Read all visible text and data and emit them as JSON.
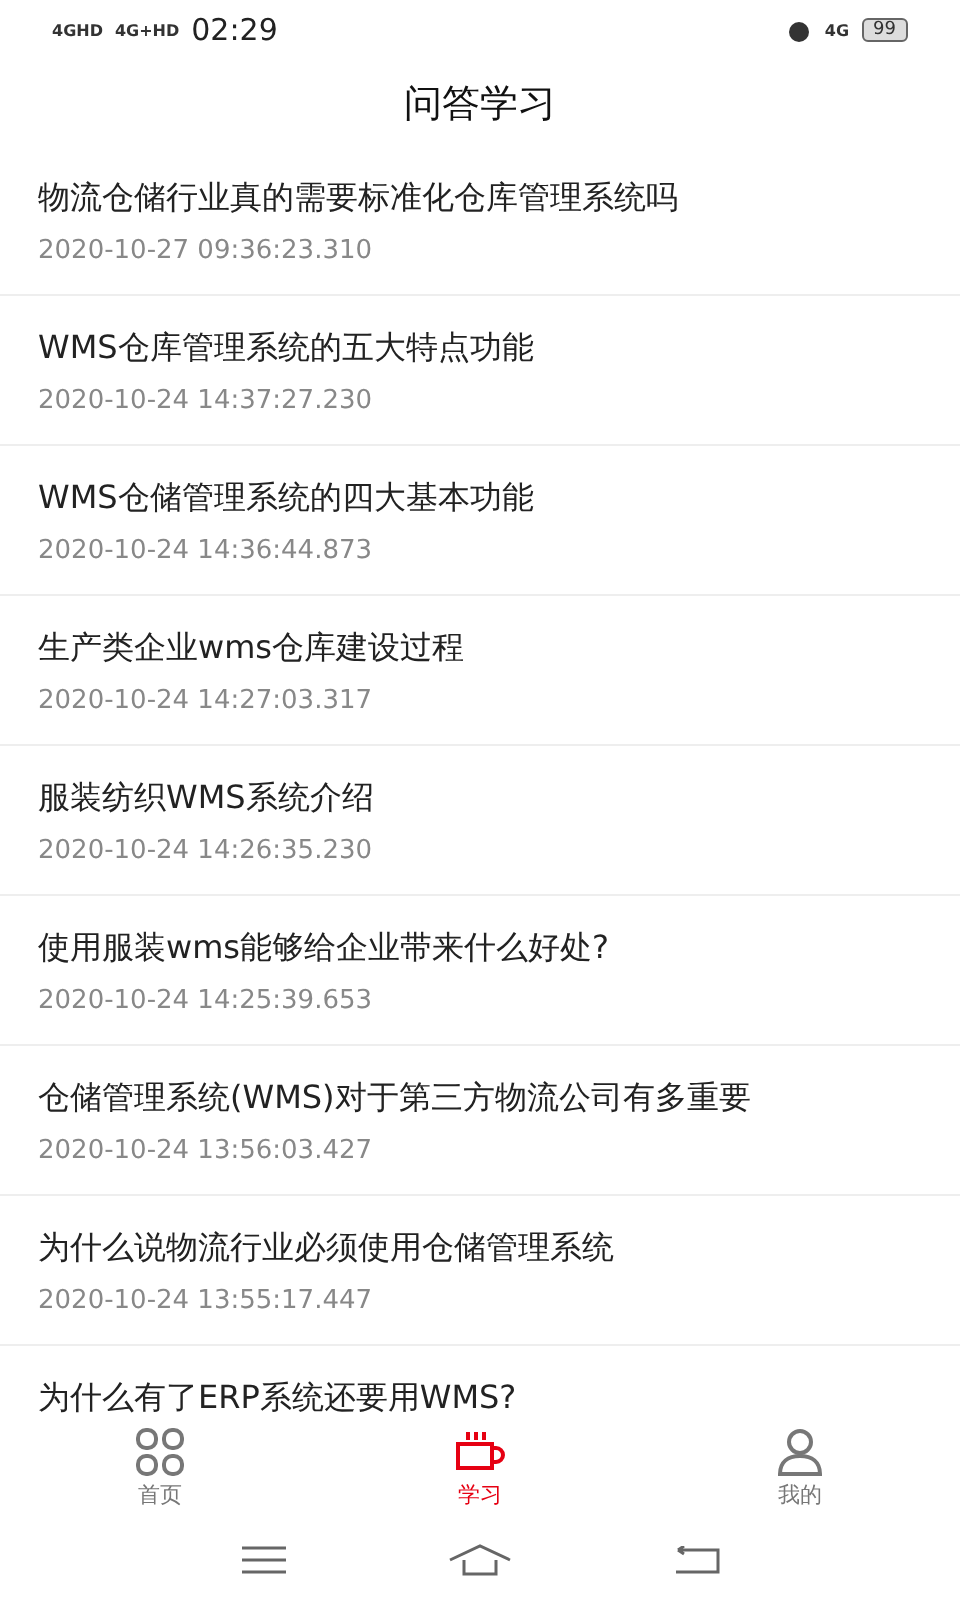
{
  "status_bar": {
    "network_1": "4GHD",
    "network_2": "4G+HD",
    "time": "02:29",
    "network_3": "4G",
    "battery": "99"
  },
  "header": {
    "title": "问答学习"
  },
  "articles": [
    {
      "title": "物流仓储行业真的需要标准化仓库管理系统吗",
      "date": "2020-10-27 09:36:23.310"
    },
    {
      "title": "WMS仓库管理系统的五大特点功能",
      "date": "2020-10-24 14:37:27.230"
    },
    {
      "title": "WMS仓储管理系统的四大基本功能",
      "date": "2020-10-24 14:36:44.873"
    },
    {
      "title": "生产类企业wms仓库建设过程",
      "date": "2020-10-24 14:27:03.317"
    },
    {
      "title": "服装纺织WMS系统介绍",
      "date": "2020-10-24 14:26:35.230"
    },
    {
      "title": "使用服装wms能够给企业带来什么好处?",
      "date": "2020-10-24 14:25:39.653"
    },
    {
      "title": "仓储管理系统(WMS)对于第三方物流公司有多重要",
      "date": "2020-10-24 13:56:03.427"
    },
    {
      "title": "为什么说物流行业必须使用仓储管理系统",
      "date": "2020-10-24 13:55:17.447"
    },
    {
      "title": "为什么有了ERP系统还要用WMS?"
    }
  ],
  "tabs": [
    {
      "kind": "home",
      "label": "首页",
      "selected": false
    },
    {
      "kind": "study",
      "label": "学习",
      "selected": true
    },
    {
      "kind": "profile",
      "label": "我的",
      "selected": false
    }
  ]
}
